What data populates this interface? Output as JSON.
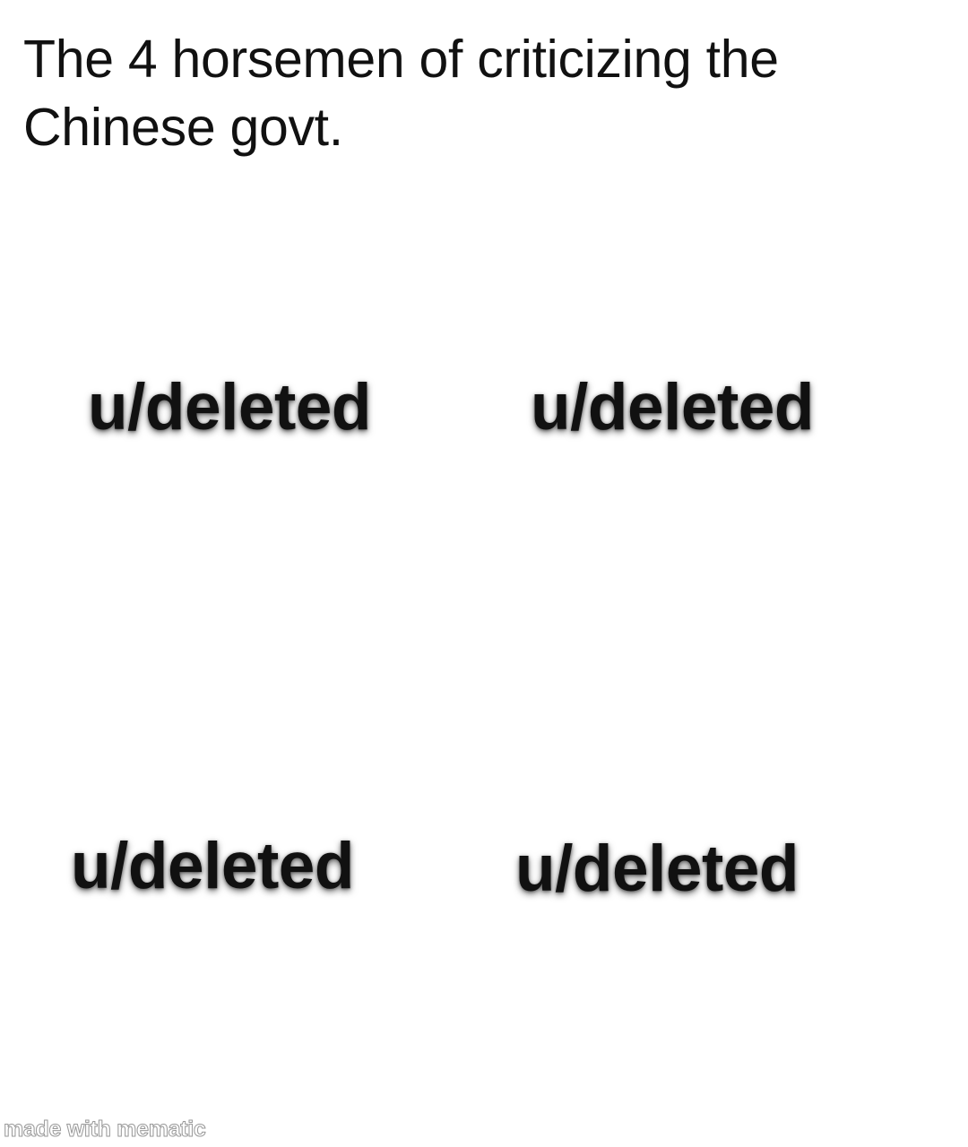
{
  "caption": {
    "lines": [
      "The 4 horsemen of criticizing the",
      "Chinese govt."
    ]
  },
  "grid": {
    "top_left": "u/deleted",
    "top_right": "u/deleted",
    "bottom_left": "u/deleted",
    "bottom_right": "u/deleted"
  },
  "watermark": "made with mematic",
  "colors": {
    "background": "#ffffff",
    "text": "#111111"
  }
}
